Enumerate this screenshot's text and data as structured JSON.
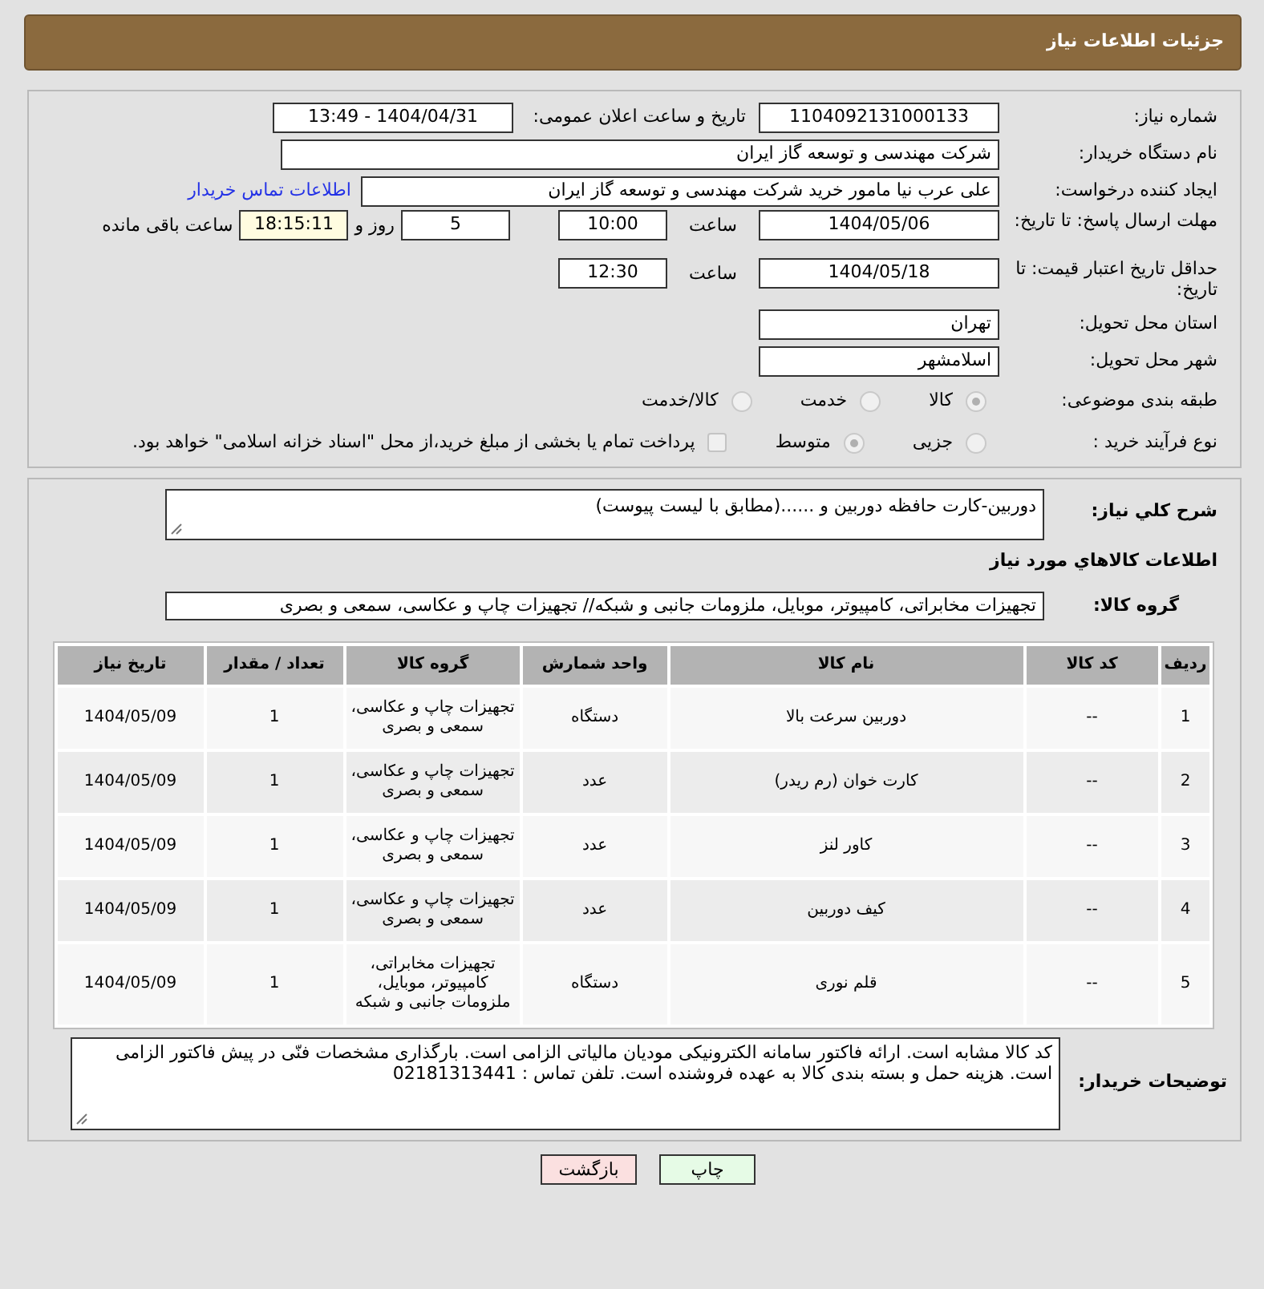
{
  "header": {
    "title": "جزئیات اطلاعات نیاز"
  },
  "need_number": {
    "label": "شماره نیاز:",
    "value": "1104092131000133"
  },
  "announce": {
    "label": "تاریخ و ساعت اعلان عمومی:",
    "value": "1404/04/31 - 13:49"
  },
  "buyer_org": {
    "label": "نام دستگاه خریدار:",
    "value": "شرکت مهندسی و توسعه گاز ایران"
  },
  "requester": {
    "label": "ایجاد کننده درخواست:",
    "value": "علی عرب نیا مامور خرید شرکت مهندسی و توسعه گاز ایران",
    "link": "اطلاعات تماس خریدار"
  },
  "reply_deadline": {
    "label": "مهلت ارسال پاسخ: تا تاریخ:",
    "date": "1404/05/06",
    "time_label": "ساعت",
    "time": "10:00",
    "days": "5",
    "days_label": "روز و",
    "remaining": "18:15:11",
    "remaining_label": "ساعت باقی مانده"
  },
  "price_validity": {
    "label": "حداقل تاریخ اعتبار قیمت: تا تاریخ:",
    "date": "1404/05/18",
    "time_label": "ساعت",
    "time": "12:30"
  },
  "province": {
    "label": "استان محل تحویل:",
    "value": "تهران"
  },
  "city": {
    "label": "شهر محل تحویل:",
    "value": "اسلامشهر"
  },
  "category": {
    "label": "طبقه بندی موضوعی:",
    "options": [
      {
        "label": "کالا",
        "selected": true
      },
      {
        "label": "خدمت",
        "selected": false
      },
      {
        "label": "کالا/خدمت",
        "selected": false
      }
    ]
  },
  "process": {
    "label": "نوع فرآیند خرید :",
    "options": [
      {
        "label": "جزیی",
        "selected": false
      },
      {
        "label": "متوسط",
        "selected": true
      }
    ],
    "payment": {
      "label": "پرداخت تمام یا بخشی از مبلغ خرید،از محل \"اسناد خزانه اسلامی\" خواهد بود.",
      "checked": false
    }
  },
  "description": {
    "label": "شرح كلي نياز:",
    "value": "دوربین-کارت حافظه دوربین و ......(مطابق با لیست پیوست)"
  },
  "items_heading": "اطلاعات كالاهاي مورد نياز",
  "goods_group": {
    "label": "گروه کالا:",
    "value": "تجهیزات مخابراتی، کامپیوتر، موبایل، ملزومات جانبی و شبکه// تجهیزات چاپ و عکاسی، سمعی و بصری"
  },
  "table": {
    "columns": [
      "ردیف",
      "کد کالا",
      "نام کالا",
      "واحد شمارش",
      "گروه کالا",
      "تعداد / مقدار",
      "تاریخ نیاز"
    ],
    "rows": [
      [
        "1",
        "--",
        "دوربین سرعت بالا",
        "دستگاه",
        "تجهیزات چاپ و عکاسی، سمعی و بصری",
        "1",
        "1404/05/09"
      ],
      [
        "2",
        "--",
        "کارت خوان (رم ریدر)",
        "عدد",
        "تجهیزات چاپ و عکاسی، سمعی و بصری",
        "1",
        "1404/05/09"
      ],
      [
        "3",
        "--",
        "کاور لنز",
        "عدد",
        "تجهیزات چاپ و عکاسی، سمعی و بصری",
        "1",
        "1404/05/09"
      ],
      [
        "4",
        "--",
        "کیف دوربین",
        "عدد",
        "تجهیزات چاپ و عکاسی، سمعی و بصری",
        "1",
        "1404/05/09"
      ],
      [
        "5",
        "--",
        "قلم نوری",
        "دستگاه",
        "تجهیزات مخابراتی، کامپیوتر، موبایل، ملزومات جانبی و شبکه",
        "1",
        "1404/05/09"
      ]
    ]
  },
  "buyer_notes": {
    "label": "توضیحات خریدار:",
    "value": "کد کالا مشابه است. ارائه فاکتور سامانه الکترونیکی مودیان مالیاتی الزامی است.  بارگذاری مشخصات فنّی در پیش فاکتور الزامی است. هزینه حمل و بسته بندی کالا به عهده فروشنده است. تلفن تماس : 02181313441"
  },
  "buttons": [
    {
      "label": "چاپ",
      "kind": "print"
    },
    {
      "label": "بازگشت",
      "kind": "back"
    }
  ]
}
